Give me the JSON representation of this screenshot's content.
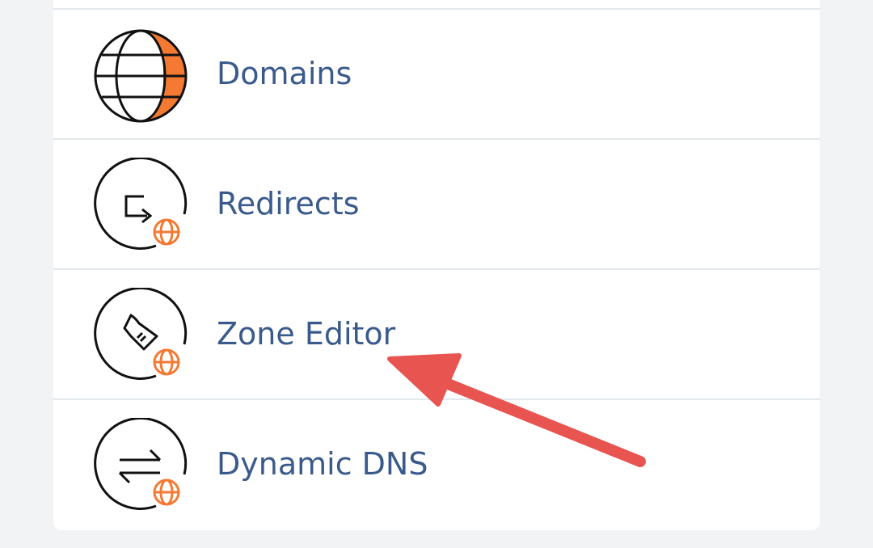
{
  "menu": {
    "items": [
      {
        "label": "Domains",
        "icon": "globe-icon"
      },
      {
        "label": "Redirects",
        "icon": "redirect-icon"
      },
      {
        "label": "Zone Editor",
        "icon": "zone-editor-icon"
      },
      {
        "label": "Dynamic DNS",
        "icon": "dynamic-dns-icon"
      }
    ]
  },
  "annotation": {
    "icon": "red-arrow-icon",
    "target": "Zone Editor",
    "color": "#e85450"
  },
  "colors": {
    "accent_orange": "#f47a34",
    "link_text": "#3a5a8c",
    "divider": "#e3e8ed",
    "background": "#f1f3f5"
  }
}
